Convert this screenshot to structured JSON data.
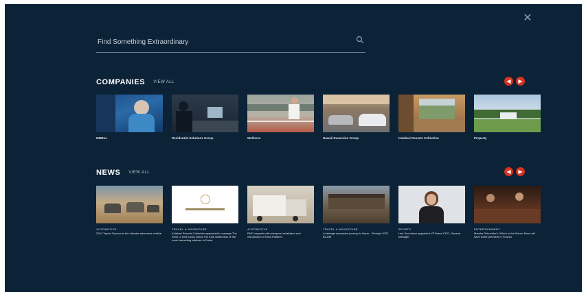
{
  "search": {
    "placeholder": "Find Something Extraordinary"
  },
  "companies": {
    "title": "COMPANIES",
    "view_all": "VIEW ALL",
    "items": [
      {
        "label": "MMBee",
        "image": "person-portrait-blue-icon"
      },
      {
        "label": "Residential Solutions Group",
        "image": "office-meeting-icon"
      },
      {
        "label": "Wellness",
        "image": "tennis-court-icon"
      },
      {
        "label": "Hawaii Excursion Group",
        "image": "garage-cars-icon"
      },
      {
        "label": "Kalahari Resorts Collection",
        "image": "open-terrace-icon"
      },
      {
        "label": "Property",
        "image": "house-landscape-icon"
      }
    ]
  },
  "news": {
    "title": "NEWS",
    "view_all": "VIEW ALL",
    "items": [
      {
        "category": "AUTOMOTIVE",
        "title": "2024 Toyota Tacoma is the ultimate adventure vehicle",
        "image": "vehicles-desert-icon"
      },
      {
        "category": "TRAVEL & ADVENTURE",
        "title": "Kalahari Resorts Collection appointed to manage The Rose, a new luxury villa in the rural wilderness of the most interesting address in Dubai",
        "image": "logo-card-icon"
      },
      {
        "category": "AUTOMOTIVE",
        "title": "RMD expands with sleepers installation and introduction of DMA Platform",
        "image": "truck-icon"
      },
      {
        "category": "TRAVEL & ADVENTURE",
        "title": "A heritage expansion journey to Harar - Ethiopia 2023 BILUM",
        "image": "building-icon"
      },
      {
        "category": "SPORTS",
        "title": "Lisa Sochelson appointed VP Brand CEO, General Manager",
        "image": "woman-portrait-icon"
      },
      {
        "category": "ENTERTAINMENT",
        "title": "Marsha Schneider's 'Who's in the Room' Move will have world premiere in Toronto",
        "image": "dinner-scene-icon"
      }
    ]
  }
}
